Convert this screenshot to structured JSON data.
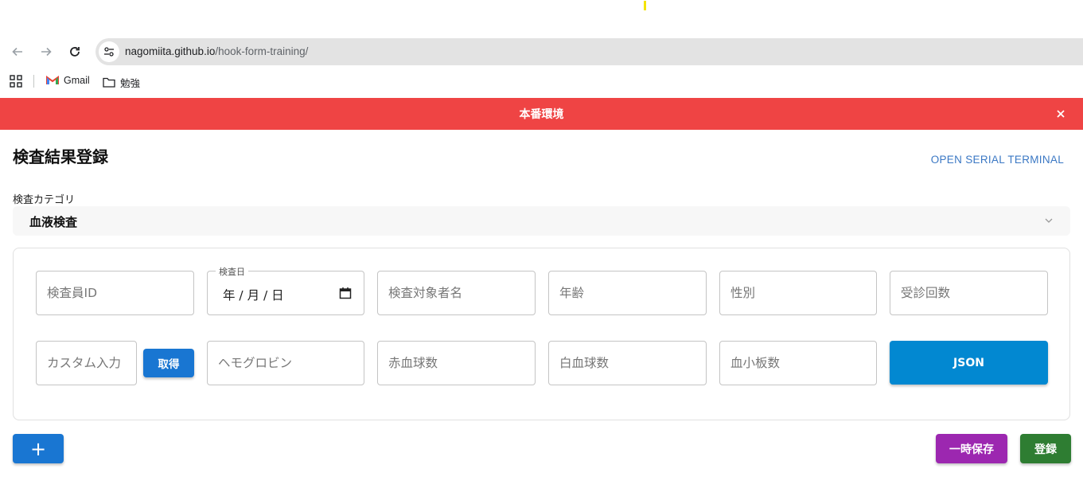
{
  "browser": {
    "url_host": "nagomiita.github.io",
    "url_path": "/hook-form-training/",
    "bookmarks": [
      {
        "label": "Gmail",
        "icon": "gmail-icon"
      },
      {
        "label": "勉強",
        "icon": "folder-icon"
      }
    ]
  },
  "banner": {
    "title": "本番環境",
    "close_icon": "close-icon",
    "color": "#ef4444"
  },
  "page": {
    "title": "検査結果登録",
    "serial_link": "OPEN SERIAL TERMINAL"
  },
  "category": {
    "label": "検査カテゴリ",
    "value": "血液検査"
  },
  "form": {
    "row1": {
      "inspector_id": "検査員ID",
      "date_label": "検査日",
      "date_value": "年 / 月 / 日",
      "subject_name": "検査対象者名",
      "age": "年齢",
      "gender": "性別",
      "visit_count": "受診回数"
    },
    "row2": {
      "custom_input": "カスタム入力",
      "fetch_button": "取得",
      "hemoglobin": "ヘモグロビン",
      "rbc": "赤血球数",
      "wbc": "白血球数",
      "platelet": "血小板数",
      "json_button": "JSON"
    }
  },
  "actions": {
    "add_button": "+",
    "temp_save_button": "一時保存",
    "register_button": "登録"
  },
  "colors": {
    "primary": "#1976d2",
    "json": "#0288d1",
    "temp_save": "#9c27b0",
    "register": "#2e7d32",
    "link": "#3b78c4"
  }
}
